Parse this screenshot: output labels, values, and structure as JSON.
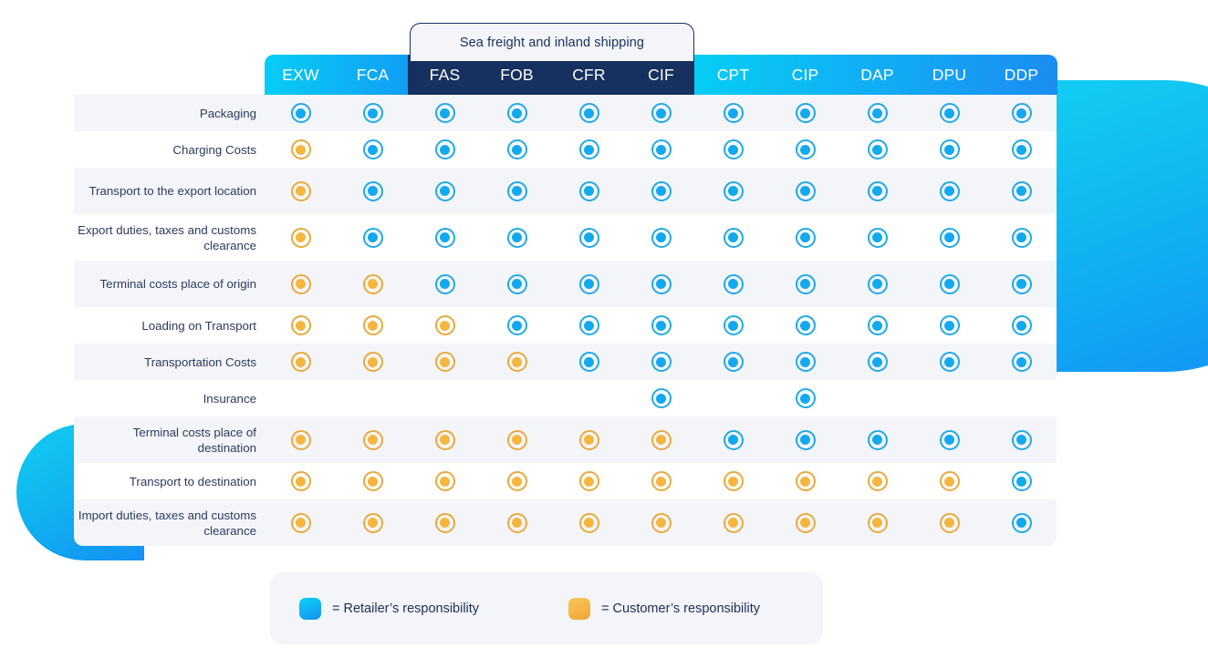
{
  "colors": {
    "retailer_blue": "#13a9ef",
    "customer_orange": "#f5b63f",
    "navy": "#16305f",
    "row_alt": "#f4f5f9"
  },
  "sea_tab": {
    "label": "Sea freight and inland shipping",
    "covers_columns": [
      "FAS",
      "FOB",
      "CFR",
      "CIF"
    ]
  },
  "columns": [
    "EXW",
    "FCA",
    "FAS",
    "FOB",
    "CFR",
    "CIF",
    "CPT",
    "CIP",
    "DAP",
    "DPU",
    "DDP"
  ],
  "rows": [
    {
      "label": "Packaging",
      "values": [
        "blue",
        "blue",
        "blue",
        "blue",
        "blue",
        "blue",
        "blue",
        "blue",
        "blue",
        "blue",
        "blue"
      ]
    },
    {
      "label": "Charging Costs",
      "values": [
        "orange",
        "blue",
        "blue",
        "blue",
        "blue",
        "blue",
        "blue",
        "blue",
        "blue",
        "blue",
        "blue"
      ]
    },
    {
      "label": "Transport to the export location",
      "values": [
        "orange",
        "blue",
        "blue",
        "blue",
        "blue",
        "blue",
        "blue",
        "blue",
        "blue",
        "blue",
        "blue"
      ]
    },
    {
      "label": "Export duties, taxes and customs clearance",
      "values": [
        "orange",
        "blue",
        "blue",
        "blue",
        "blue",
        "blue",
        "blue",
        "blue",
        "blue",
        "blue",
        "blue"
      ]
    },
    {
      "label": "Terminal costs place of origin",
      "values": [
        "orange",
        "orange",
        "blue",
        "blue",
        "blue",
        "blue",
        "blue",
        "blue",
        "blue",
        "blue",
        "blue"
      ]
    },
    {
      "label": "Loading on Transport",
      "values": [
        "orange",
        "orange",
        "orange",
        "blue",
        "blue",
        "blue",
        "blue",
        "blue",
        "blue",
        "blue",
        "blue"
      ]
    },
    {
      "label": "Transportation Costs",
      "values": [
        "orange",
        "orange",
        "orange",
        "orange",
        "blue",
        "blue",
        "blue",
        "blue",
        "blue",
        "blue",
        "blue"
      ]
    },
    {
      "label": "Insurance",
      "values": [
        "none",
        "none",
        "none",
        "none",
        "none",
        "blue",
        "none",
        "blue",
        "none",
        "none",
        "none"
      ]
    },
    {
      "label": "Terminal costs place of destination",
      "values": [
        "orange",
        "orange",
        "orange",
        "orange",
        "orange",
        "orange",
        "blue",
        "blue",
        "blue",
        "blue",
        "blue"
      ]
    },
    {
      "label": "Transport to destination",
      "values": [
        "orange",
        "orange",
        "orange",
        "orange",
        "orange",
        "orange",
        "orange",
        "orange",
        "orange",
        "orange",
        "blue"
      ]
    },
    {
      "label": "Import duties, taxes and customs clearance",
      "values": [
        "orange",
        "orange",
        "orange",
        "orange",
        "orange",
        "orange",
        "orange",
        "orange",
        "orange",
        "orange",
        "blue"
      ]
    }
  ],
  "legend": {
    "retailer": "= Retailer’s responsibility",
    "customer": "= Customer’s responsibility"
  }
}
